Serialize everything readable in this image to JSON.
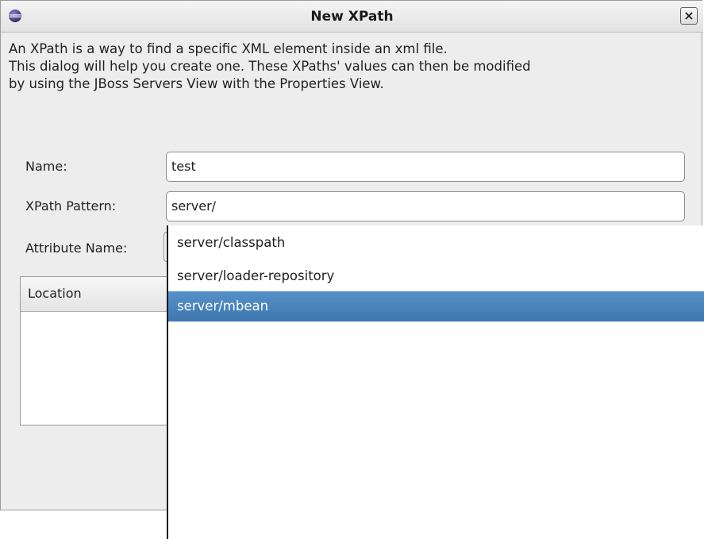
{
  "window": {
    "title": "New XPath",
    "close_glyph": "×",
    "icon": "eclipse-app-icon"
  },
  "description": {
    "lines": [
      "An XPath is a way to find a specific XML element inside an xml file.",
      "This dialog will help you create one. These XPaths' values can then be modified",
      "by using the JBoss Servers View with the Properties View."
    ]
  },
  "form": {
    "name_label": "Name:",
    "name_value": "test",
    "xpath_label": "XPath Pattern:",
    "xpath_value": "server/",
    "attribute_label": "Attribute Name:"
  },
  "table": {
    "column_location": "Location"
  },
  "autocomplete": {
    "items": [
      {
        "label": "server/classpath",
        "selected": false
      },
      {
        "label": "server/loader-repository",
        "selected": false
      },
      {
        "label": "server/mbean",
        "selected": true
      }
    ]
  },
  "colors": {
    "selection": "#4a84bc",
    "dialog_bg": "#ededed"
  }
}
